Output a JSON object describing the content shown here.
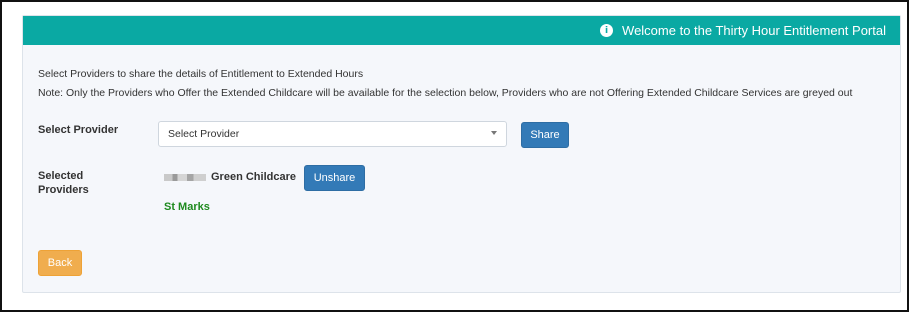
{
  "header": {
    "title": "Welcome to the Thirty Hour Entitlement Portal",
    "icon": "info-circle-icon"
  },
  "intro_text": "Select Providers to share the details of Entitlement to Extended Hours",
  "note_text": "Note: Only the Providers who Offer the Extended Childcare will be available for the selection below, Providers who are not Offering Extended Childcare Services are greyed out",
  "select_provider": {
    "label": "Select Provider",
    "selected_value": "Select Provider",
    "share_label": "Share"
  },
  "selected_providers": {
    "label_line1": "Selected",
    "label_line2": "Providers",
    "items": [
      {
        "name": "Green Childcare",
        "unshare_label": "Unshare"
      },
      {
        "name": "St Marks"
      }
    ]
  },
  "back_label": "Back",
  "colors": {
    "header_bg": "#0aa9a3",
    "primary_button": "#337ab7",
    "back_button": "#f0ad4e",
    "provider_green": "#1e8a1e"
  }
}
